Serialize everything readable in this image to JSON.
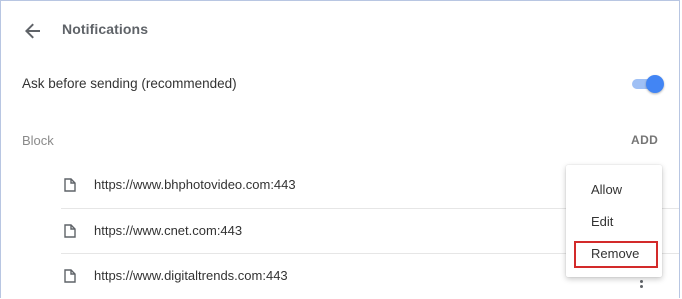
{
  "header": {
    "title": "Notifications",
    "back_icon": "arrow-back-icon"
  },
  "settings": {
    "ask_label": "Ask before sending (recommended)",
    "ask_enabled": true
  },
  "block_section": {
    "label": "Block",
    "add_label": "ADD",
    "sites": [
      {
        "url": "https://www.bhphotovideo.com:443",
        "icon": "file-icon"
      },
      {
        "url": "https://www.cnet.com:443",
        "icon": "file-icon"
      },
      {
        "url": "https://www.digitaltrends.com:443",
        "icon": "file-icon"
      }
    ]
  },
  "context_menu": {
    "items": [
      "Allow",
      "Edit",
      "Remove"
    ],
    "highlighted": "Remove"
  },
  "colors": {
    "accent": "#4285f4",
    "toggle_track": "#9fc0f5",
    "highlight_border": "#d32a2a"
  }
}
